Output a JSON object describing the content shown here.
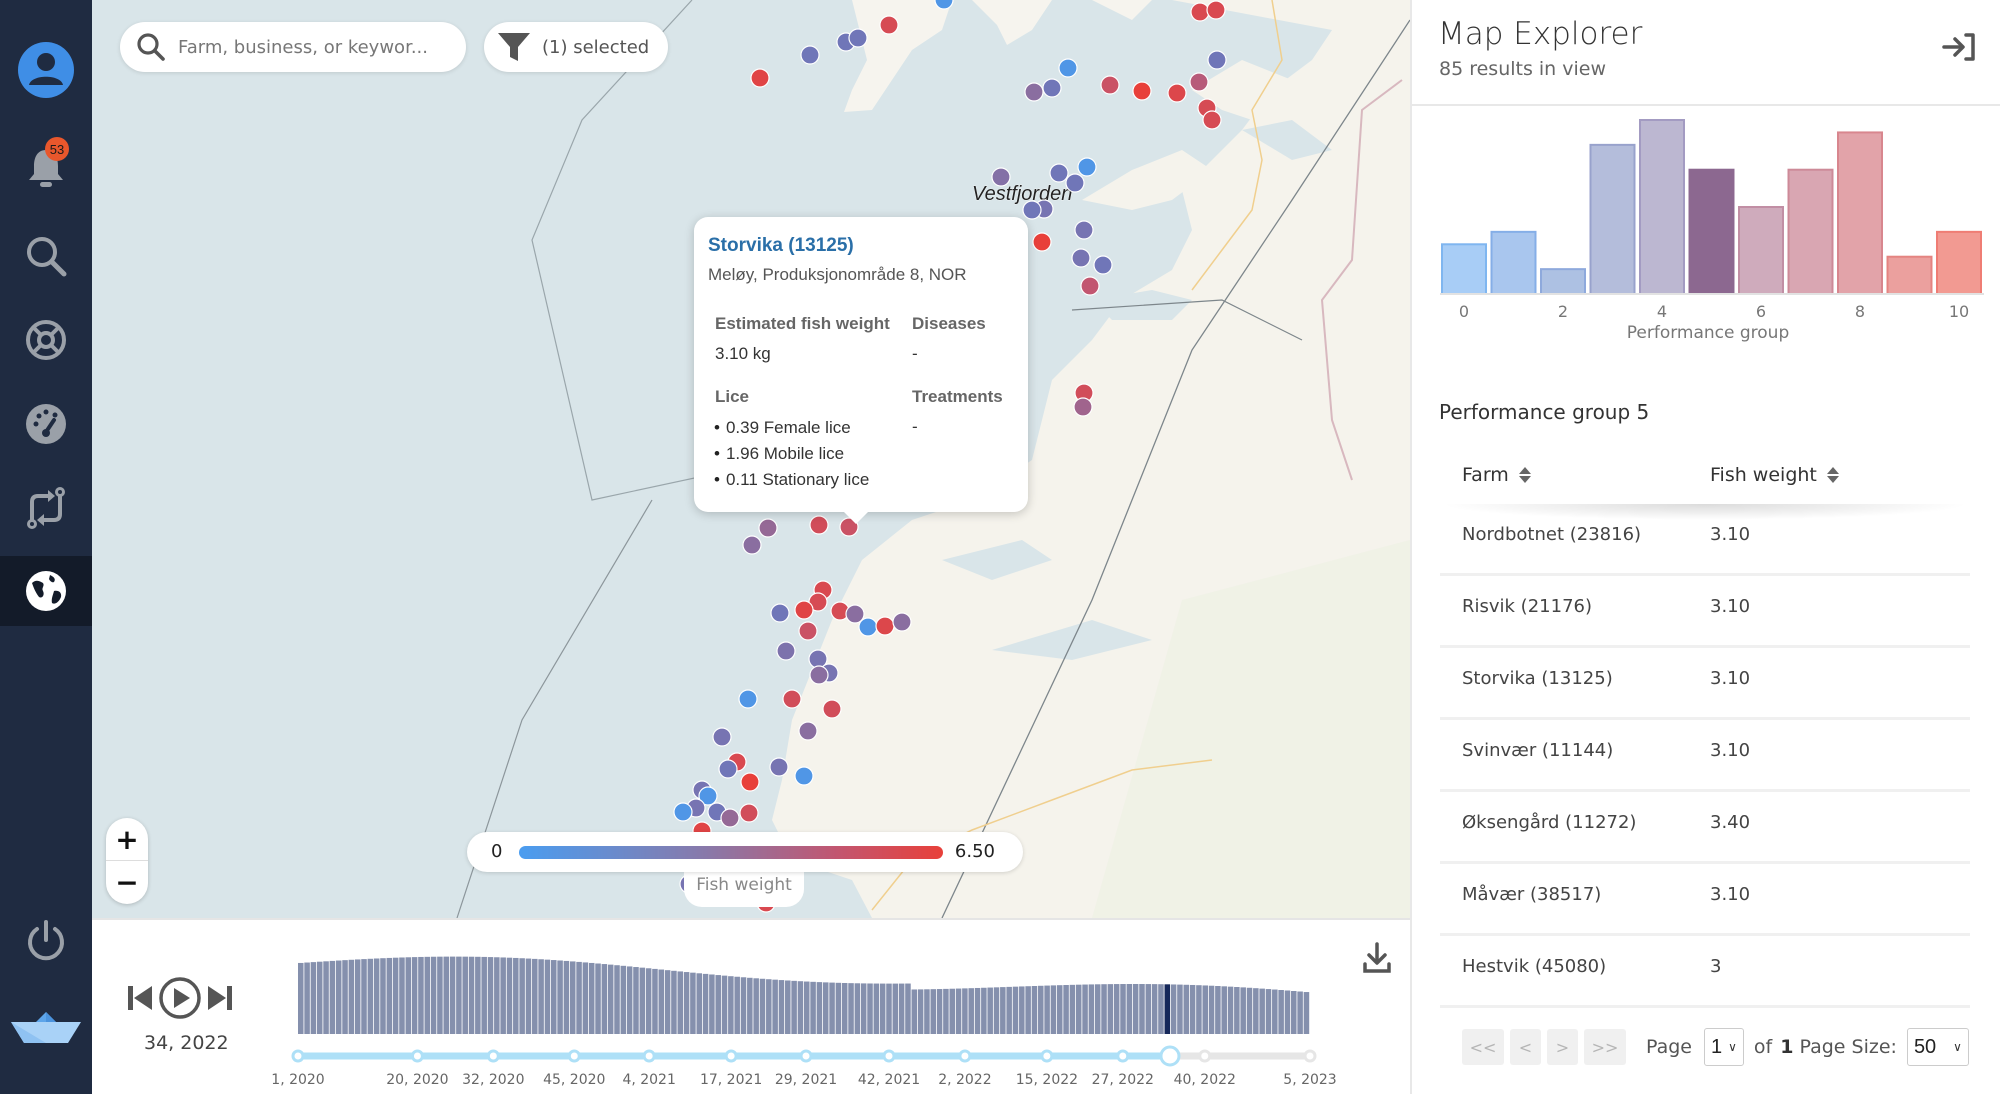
{
  "sidebar": {
    "items": [
      {
        "name": "profile",
        "icon": "user-icon"
      },
      {
        "name": "notifications",
        "icon": "bell-icon",
        "badge": "53"
      },
      {
        "name": "search",
        "icon": "search-icon"
      },
      {
        "name": "support",
        "icon": "lifebuoy-icon"
      },
      {
        "name": "dashboard",
        "icon": "gauge-icon"
      },
      {
        "name": "flows",
        "icon": "transfer-icon"
      },
      {
        "name": "map",
        "icon": "globe-icon",
        "active": true
      },
      {
        "name": "logout",
        "icon": "power-icon"
      }
    ],
    "logo": "paper-boat-logo"
  },
  "map": {
    "search": {
      "placeholder": "Farm, business, or keywor...",
      "value": ""
    },
    "filter": {
      "label": "(1) selected"
    },
    "zoom": {
      "in": "+",
      "out": "−"
    },
    "place_label": "Vestfjorden",
    "legend": {
      "min": "0",
      "max": "6.50",
      "title": "Fish weight",
      "color_low": "#4a9df0",
      "color_high": "#e8403a"
    },
    "popup": {
      "title": "Storvika (13125)",
      "subtitle": "Meløy, Produksjonområde 8, NOR",
      "weight_label": "Estimated fish weight",
      "weight_value": "3.10 kg",
      "diseases_label": "Diseases",
      "diseases_value": "-",
      "lice_label": "Lice",
      "lice": [
        "0.39 Female lice",
        "1.96 Mobile lice",
        "0.11 Stationary lice"
      ],
      "treatments_label": "Treatments",
      "treatments_value": "-"
    }
  },
  "timeline": {
    "current": "34, 2022",
    "ticks": [
      "1, 2020",
      "20, 2020",
      "32, 2020",
      "45, 2020",
      "4, 2021",
      "17, 2021",
      "29, 2021",
      "42, 2021",
      "2, 2022",
      "15, 2022",
      "27, 2022",
      "40, 2022",
      "5, 2023"
    ],
    "progress": 0.86
  },
  "panel": {
    "title": "Map Explorer",
    "results": "85 results in view",
    "histogram": {
      "xlabel": "Performance group",
      "tick_labels": [
        "0",
        "2",
        "4",
        "6",
        "8",
        "10"
      ],
      "groups": [
        0,
        1,
        2,
        3,
        4,
        5,
        6,
        7,
        8,
        9,
        10
      ],
      "counts": [
        4,
        5,
        2,
        12,
        14,
        10,
        7,
        10,
        13,
        3,
        5
      ],
      "selected": 5
    },
    "group_title": "Performance group 5",
    "columns": [
      "Farm",
      "Fish weight"
    ],
    "rows": [
      {
        "farm": "Nordbotnet (23816)",
        "weight": "3.10"
      },
      {
        "farm": "Risvik (21176)",
        "weight": "3.10"
      },
      {
        "farm": "Storvika (13125)",
        "weight": "3.10"
      },
      {
        "farm": "Svinvær (11144)",
        "weight": "3.10"
      },
      {
        "farm": "Øksengård (11272)",
        "weight": "3.40"
      },
      {
        "farm": "Måvær (38517)",
        "weight": "3.10"
      },
      {
        "farm": "Hestvik (45080)",
        "weight": "3"
      }
    ],
    "pager": {
      "first": "<<",
      "prev": "<",
      "next": ">",
      "last": ">>",
      "page_label": "Page",
      "page": "1",
      "of_label": "of",
      "total": "1",
      "size_label": "Page Size:",
      "size": "50"
    }
  }
}
